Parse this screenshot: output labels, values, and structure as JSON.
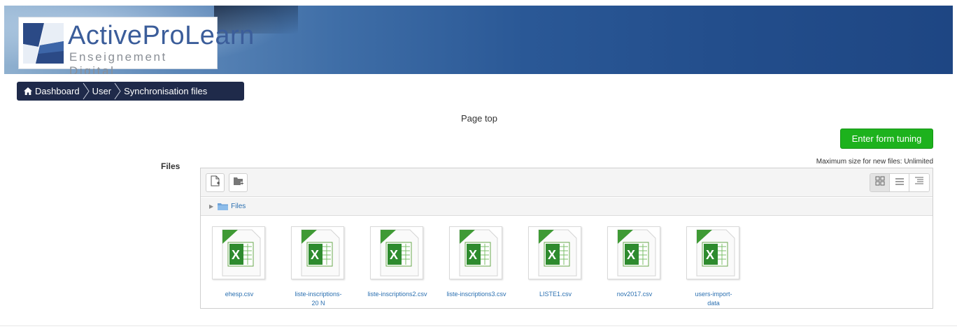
{
  "header": {
    "logo_title": "ActiveProLearn",
    "logo_subtitle": "Enseignement Digital"
  },
  "breadcrumb": {
    "items": [
      {
        "label": "Dashboard",
        "icon": "home-icon"
      },
      {
        "label": "User"
      },
      {
        "label": "Synchronisation files"
      }
    ]
  },
  "main": {
    "page_top": "Page top",
    "enter_form_button": "Enter form tuning",
    "files_label": "Files",
    "max_size": "Maximum size for new files: Unlimited"
  },
  "filemanager": {
    "toolbar": {
      "add_file_icon": "add-file-icon",
      "create_folder_icon": "create-folder-icon",
      "views": [
        "icons-view-icon",
        "list-view-icon",
        "tree-view-icon"
      ],
      "active_view": "icons-view-icon"
    },
    "path": {
      "label": "Files"
    },
    "files": [
      {
        "name": "ehesp.csv",
        "icon": "excel-file-icon"
      },
      {
        "name": "liste-inscriptions-\n20 N",
        "icon": "excel-file-icon"
      },
      {
        "name": "liste-inscriptions2.csv",
        "icon": "excel-file-icon"
      },
      {
        "name": "liste-inscriptions3.csv",
        "icon": "excel-file-icon"
      },
      {
        "name": "LISTE1.csv",
        "icon": "excel-file-icon"
      },
      {
        "name": "nov2017.csv",
        "icon": "excel-file-icon"
      },
      {
        "name": "users-import-\ndata",
        "icon": "excel-file-icon"
      }
    ]
  },
  "colors": {
    "breadcrumb_bg": "#1f2a4a",
    "green_button": "#1db21d",
    "link_blue": "#2a6fb0",
    "logo_blue": "#3b5d9a"
  }
}
